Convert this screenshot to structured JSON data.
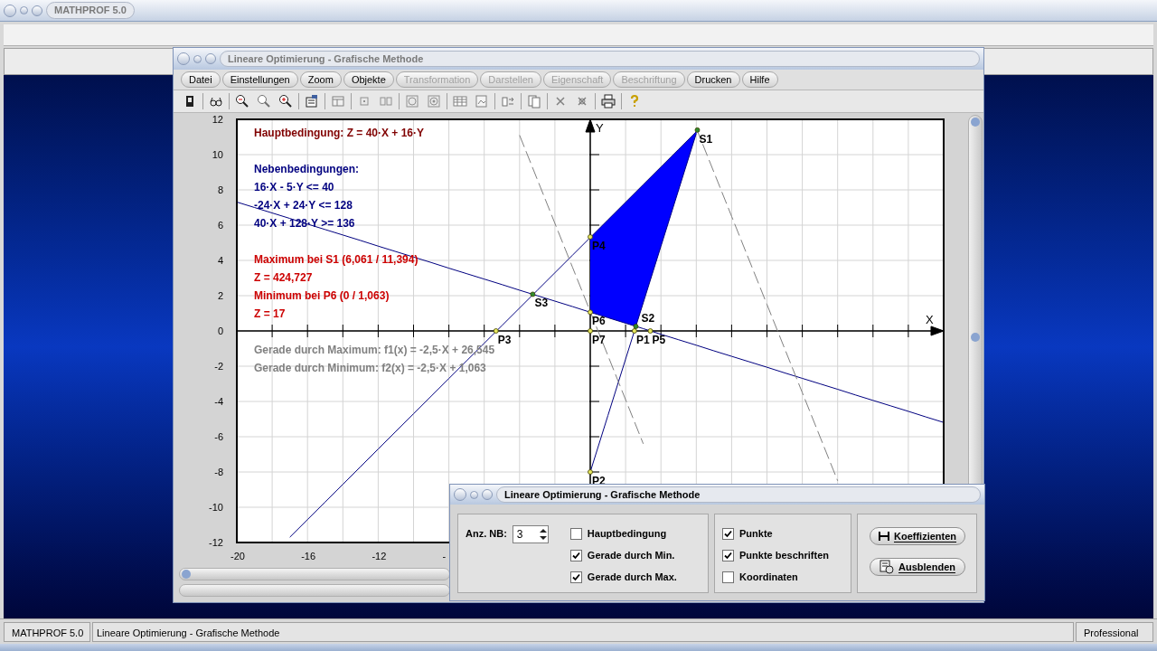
{
  "app": {
    "title": "MATHPROF 5.0"
  },
  "main_window": {
    "title": "Lineare Optimierung - Grafische Methode",
    "menu": [
      {
        "label": "Datei",
        "disabled": false
      },
      {
        "label": "Einstellungen",
        "disabled": false
      },
      {
        "label": "Zoom",
        "disabled": false
      },
      {
        "label": "Objekte",
        "disabled": false
      },
      {
        "label": "Transformation",
        "disabled": true
      },
      {
        "label": "Darstellen",
        "disabled": true
      },
      {
        "label": "Eigenschaft",
        "disabled": true
      },
      {
        "label": "Beschriftung",
        "disabled": true
      },
      {
        "label": "Drucken",
        "disabled": false
      },
      {
        "label": "Hilfe",
        "disabled": false
      }
    ],
    "plot": {
      "info": [
        {
          "color": "#800000",
          "lines": [
            "Hauptbedingung: Z = 40·X + 16·Y"
          ]
        },
        {
          "color": "#000080",
          "lines": [
            "Nebenbedingungen:",
            "16·X - 5·Y <= 40",
            "-24·X + 24·Y <= 128",
            "40·X + 128·Y >= 136"
          ]
        },
        {
          "color": "#cc0000",
          "lines": [
            "Maximum bei S1 (6,061 / 11,394)",
            "Z = 424,727",
            "Minimum bei P6 (0 / 1,063)",
            "Z = 17"
          ]
        },
        {
          "color": "#808080",
          "lines": [
            "Gerade durch Maximum: f1(x) = -2,5·X + 26,545",
            "Gerade durch Minimum: f2(x) = -2,5·X + 1,063"
          ]
        }
      ],
      "chart_data": {
        "type": "line",
        "xlabel": "X",
        "ylabel": "Y",
        "xlim": [
          -20,
          20
        ],
        "ylim": [
          -12,
          12
        ],
        "grid": true,
        "xticks": [
          -20,
          -16,
          -12,
          {
            "value": -8,
            "label": "-"
          }
        ],
        "yticks": [
          -12,
          -10,
          -8,
          -6,
          -4,
          -2,
          0,
          2,
          4,
          6,
          8,
          10,
          12
        ],
        "x": [
          -20,
          -19,
          -18,
          -17,
          -16,
          -15,
          -14,
          -13,
          -12,
          -11,
          -10,
          -9,
          -8,
          -7,
          -6,
          -5,
          -4,
          -3,
          -2,
          -1,
          0,
          1,
          2,
          3,
          4,
          5,
          6,
          7,
          8,
          9,
          10,
          11,
          12,
          13,
          14,
          15,
          16,
          17,
          18,
          19,
          20
        ],
        "series": [
          {
            "line_style": "solid",
            "color": "#000080",
            "values": [
              null,
              null,
              null,
              null,
              null,
              null,
              null,
              null,
              null,
              null,
              null,
              null,
              null,
              null,
              null,
              null,
              null,
              null,
              null,
              null,
              -8,
              -4.8,
              -1.6,
              1.6,
              4.8,
              8,
              11.2,
              null,
              null,
              null,
              null,
              null,
              null,
              null,
              null,
              null,
              null,
              null,
              null,
              null,
              null
            ]
          },
          {
            "line_style": "solid",
            "color": "#000080",
            "values": [
              null,
              null,
              null,
              -11.7,
              -10.7,
              -9.7,
              -8.7,
              -7.7,
              -6.7,
              -5.7,
              -4.7,
              -3.7,
              -2.7,
              -1.7,
              -0.7,
              0.3,
              1.3,
              2.3,
              3.3,
              4.3,
              5.3,
              6.3,
              7.3,
              8.3,
              9.3,
              10.3,
              11.3,
              null,
              null,
              null,
              null,
              null,
              null,
              null,
              null,
              null,
              null,
              null,
              null,
              null,
              null
            ]
          },
          {
            "line_style": "solid",
            "color": "#000080",
            "values": [
              7.31,
              7,
              6.69,
              6.38,
              6.06,
              5.75,
              5.44,
              5.13,
              4.81,
              4.5,
              4.19,
              3.88,
              3.56,
              3.25,
              2.94,
              2.63,
              2.31,
              2,
              1.69,
              1.38,
              1.06,
              0.75,
              0.44,
              0.13,
              -0.19,
              -0.5,
              -0.81,
              -1.13,
              -1.44,
              -1.75,
              -2.06,
              -2.38,
              -2.69,
              -3,
              -3.31,
              -3.63,
              -3.94,
              -4.25,
              -4.56,
              -4.88,
              -5.19
            ]
          },
          {
            "line_style": "dashed",
            "color": "#808080",
            "values": [
              null,
              null,
              null,
              null,
              null,
              null,
              null,
              null,
              null,
              null,
              null,
              null,
              null,
              null,
              null,
              null,
              null,
              null,
              null,
              null,
              null,
              null,
              null,
              null,
              null,
              null,
              11.5,
              9,
              6.5,
              4,
              1.5,
              -1,
              -3.5,
              -6,
              -8.5,
              null,
              null,
              null,
              null,
              null,
              null
            ]
          },
          {
            "line_style": "dashed",
            "color": "#808080",
            "values": [
              null,
              null,
              null,
              null,
              null,
              null,
              null,
              null,
              null,
              null,
              null,
              null,
              null,
              null,
              null,
              null,
              11.1,
              8.6,
              6.1,
              3.6,
              1.1,
              -1.4,
              -3.9,
              -6.4,
              null,
              null,
              null,
              null,
              null,
              null,
              null,
              null,
              null,
              null,
              null,
              null,
              null,
              null,
              null,
              null,
              null
            ]
          }
        ],
        "annotations": [
          {
            "text": "S1",
            "x": 6.061,
            "y": 11.394
          },
          {
            "text": "P4",
            "x": 0,
            "y": 5.333
          },
          {
            "text": "S3",
            "x": -3.254,
            "y": 2.079
          },
          {
            "text": "P6",
            "x": 0,
            "y": 1.063
          },
          {
            "text": "P3",
            "x": -5.333,
            "y": 0
          },
          {
            "text": "P7",
            "x": 0,
            "y": 0
          },
          {
            "text": "P1",
            "x": 2.5,
            "y": 0
          },
          {
            "text": "S2",
            "x": 2.58,
            "y": 0.256
          },
          {
            "text": "P5",
            "x": 3.4,
            "y": 0
          },
          {
            "text": "P2",
            "x": 0,
            "y": -8
          }
        ]
      }
    }
  },
  "dialog": {
    "title": "Lineare Optimierung - Grafische Methode",
    "count": {
      "label": "Anz. NB:",
      "value": "3"
    },
    "options_left": [
      {
        "label": "Hauptbedingung",
        "checked": false
      },
      {
        "label": "Gerade durch Min.",
        "checked": true
      },
      {
        "label": "Gerade durch Max.",
        "checked": true
      }
    ],
    "options_right": [
      {
        "label": "Punkte",
        "checked": true
      },
      {
        "label": "Punkte beschriften",
        "checked": true
      },
      {
        "label": "Koordinaten",
        "checked": false
      }
    ],
    "buttons": [
      {
        "label": "Koeffizienten",
        "kind": "coefficients"
      },
      {
        "label": "Ausblenden",
        "kind": "hide"
      }
    ]
  },
  "status_bar": [
    "MATHPROF 5.0",
    "Lineare Optimierung - Grafische Methode",
    "Professional"
  ]
}
